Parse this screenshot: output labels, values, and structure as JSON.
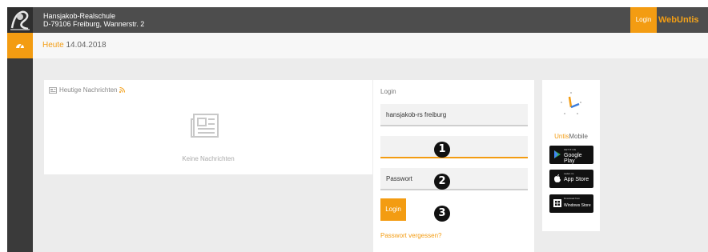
{
  "header": {
    "school_name": "Hansjakob-Realschule",
    "school_address": "D-79106 Freiburg, Wannerstr. 2",
    "login_label": "Login",
    "brand_web": "Web",
    "brand_untis": "Untis"
  },
  "datebar": {
    "today_label": "Heute",
    "date": "14.04.2018"
  },
  "news": {
    "title": "Heutige Nachrichten",
    "empty_text": "Keine Nachrichten"
  },
  "login": {
    "title": "Login",
    "school_value": "hansjakob-rs freiburg",
    "username_value": "",
    "password_placeholder": "Passwort",
    "button_label": "Login",
    "forgot_label": "Passwort vergessen?"
  },
  "markers": [
    "1",
    "2",
    "3"
  ],
  "mobile": {
    "label_untis": "Untis",
    "label_mobile": "Mobile",
    "google_small": "GET IT ON",
    "google_big": "Google Play",
    "apple_small": "Laden im",
    "apple_big": "App Store",
    "windows_small": "Download from",
    "windows_big": "Windows Store"
  },
  "colors": {
    "accent": "#f39c12",
    "topbar": "#4d4d4d",
    "sidestrip": "#3a3a3a"
  }
}
